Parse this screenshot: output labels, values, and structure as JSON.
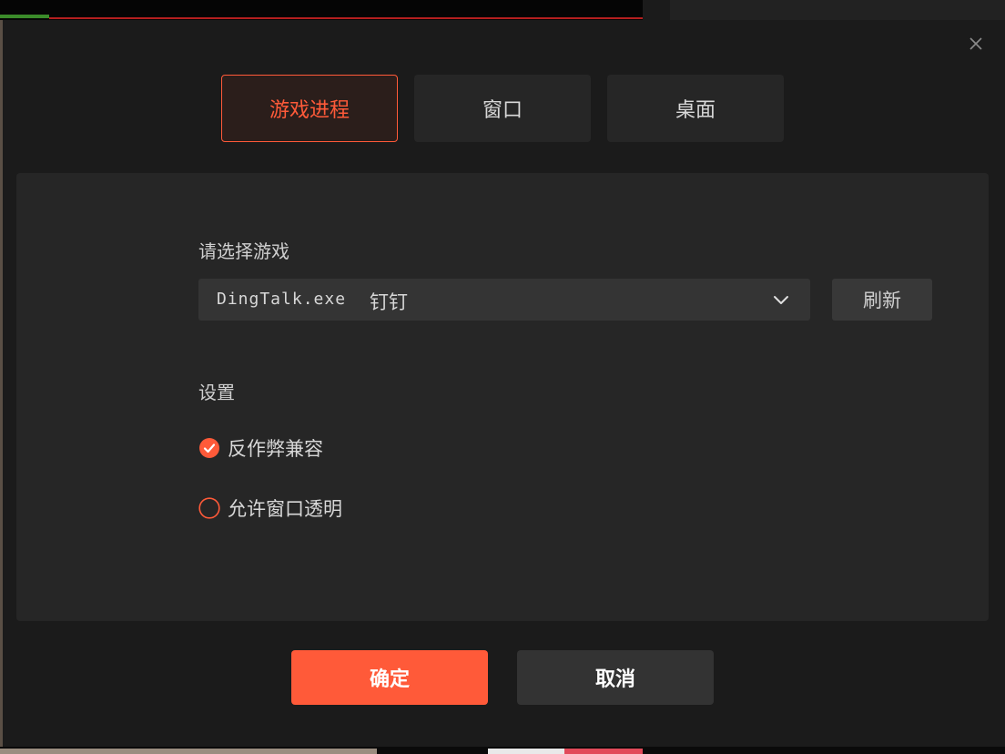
{
  "colors": {
    "accent": "#ff5a39",
    "dialog_bg": "#1b1b1b",
    "panel_bg": "#262626",
    "text": "#d8d8d8"
  },
  "tabs": [
    {
      "label": "游戏进程",
      "active": true
    },
    {
      "label": "窗口",
      "active": false
    },
    {
      "label": "桌面",
      "active": false
    }
  ],
  "game": {
    "label": "请选择游戏",
    "selected_exe": "DingTalk.exe",
    "selected_name": "钉钉",
    "refresh_label": "刷新"
  },
  "settings": {
    "label": "设置",
    "options": [
      {
        "label": "反作弊兼容",
        "checked": true
      },
      {
        "label": "允许窗口透明",
        "checked": false
      }
    ]
  },
  "footer": {
    "confirm_label": "确定",
    "cancel_label": "取消"
  },
  "icons": {
    "close": "close-icon",
    "dropdown": "chevron-down-icon",
    "checked": "check-circle-icon",
    "unchecked": "circle-icon"
  }
}
